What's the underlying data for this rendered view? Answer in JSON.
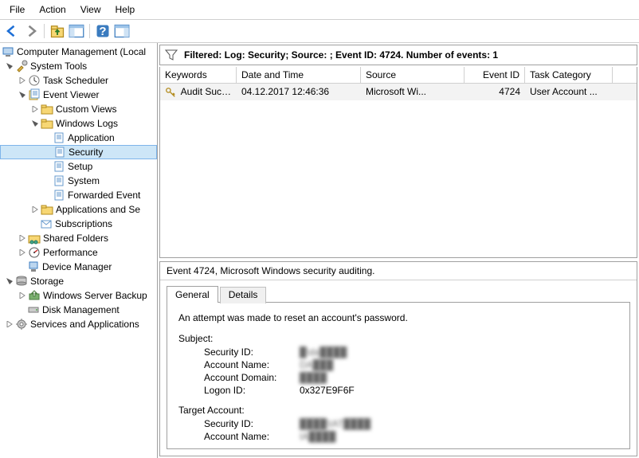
{
  "menu": {
    "file": "File",
    "action": "Action",
    "view": "View",
    "help": "Help"
  },
  "tree": {
    "root": "Computer Management (Local",
    "system_tools": "System Tools",
    "task_scheduler": "Task Scheduler",
    "event_viewer": "Event Viewer",
    "custom_views": "Custom Views",
    "windows_logs": "Windows Logs",
    "application": "Application",
    "security": "Security",
    "setup": "Setup",
    "system": "System",
    "forwarded": "Forwarded Event",
    "apps_services": "Applications and Se",
    "subscriptions": "Subscriptions",
    "shared_folders": "Shared Folders",
    "performance": "Performance",
    "device_manager": "Device Manager",
    "storage": "Storage",
    "wsb": "Windows Server Backup",
    "disk_mgmt": "Disk Management",
    "services_apps": "Services and Applications"
  },
  "filter": "Filtered: Log: Security; Source: ; Event ID: 4724. Number of events: 1",
  "grid": {
    "headers": {
      "keywords": "Keywords",
      "datetime": "Date and Time",
      "source": "Source",
      "eventid": "Event ID",
      "taskcat": "Task Category"
    },
    "rows": [
      {
        "keywords": "Audit Succ...",
        "datetime": "04.12.2017 12:46:36",
        "source": "Microsoft Wi...",
        "eventid": "4724",
        "taskcat": "User Account ..."
      }
    ]
  },
  "detail": {
    "title": "Event 4724, Microsoft Windows security auditing.",
    "tabs": {
      "general": "General",
      "details": "Details"
    },
    "message": "An attempt was made to reset an account's password.",
    "subject_hdr": "Subject:",
    "target_hdr": "Target Account:",
    "labels": {
      "sid": "Security ID:",
      "acct_name": "Account Name:",
      "acct_domain": "Account Domain:",
      "logon_id": "Logon ID:"
    },
    "subject": {
      "sid": "█\\da████",
      "name": "DA███",
      "domain": "████",
      "logon": "0x327E9F6F"
    },
    "target": {
      "sid": "████\\IAT████",
      "name": "IA████"
    }
  }
}
